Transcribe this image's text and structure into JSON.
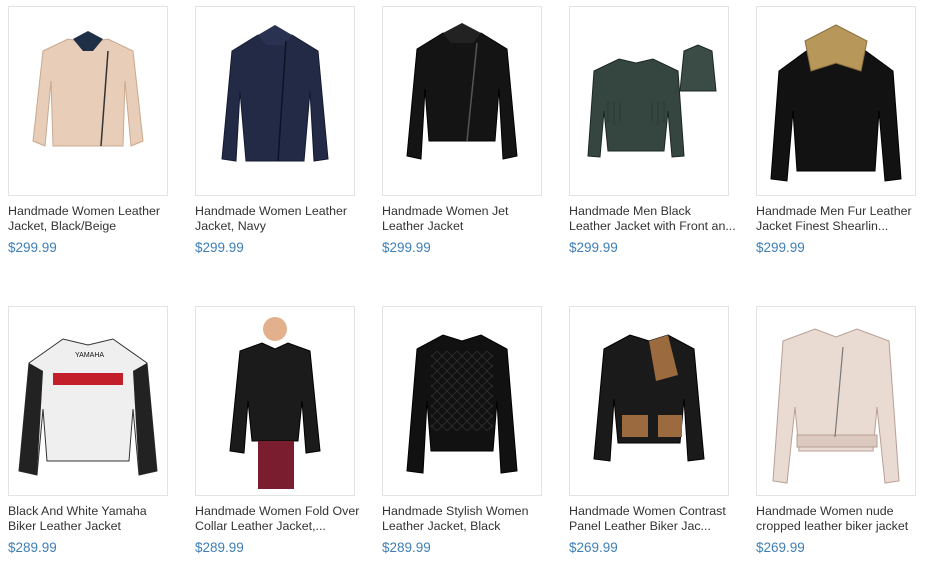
{
  "products": [
    {
      "title_line1": "Handmade Women Leather",
      "title_line2": "Jacket, Black/Beige",
      "price": "$299.99",
      "image": "beige-women-jacket"
    },
    {
      "title_line1": "Handmade Women Leather",
      "title_line2": "Jacket, Navy",
      "price": "$299.99",
      "image": "navy-women-jacket"
    },
    {
      "title_line1": "Handmade Women Jet",
      "title_line2": "Leather Jacket",
      "price": "$299.99",
      "image": "black-jet-jacket"
    },
    {
      "title_line1": "Handmade Men Black",
      "title_line2": "Leather Jacket with Front an...",
      "price": "$299.99",
      "image": "fringe-jacket"
    },
    {
      "title_line1": "Handmade Men Fur Leather",
      "title_line2": "Jacket Finest Shearlin...",
      "price": "$299.99",
      "image": "shearling-jacket"
    },
    {
      "title_line1": "Black And White Yamaha",
      "title_line2": "Biker Leather Jacket",
      "price": "$289.99",
      "image": "yamaha-jacket"
    },
    {
      "title_line1": "Handmade Women Fold Over",
      "title_line2": "Collar Leather Jacket,...",
      "price": "$289.99",
      "image": "fold-collar-jacket"
    },
    {
      "title_line1": "Handmade Stylish Women",
      "title_line2": "Leather Jacket, Black",
      "price": "$289.99",
      "image": "quilted-jacket"
    },
    {
      "title_line1": "Handmade Women Contrast",
      "title_line2": "Panel Leather Biker Jac...",
      "price": "$269.99",
      "image": "contrast-panel-jacket"
    },
    {
      "title_line1": "Handmade Women nude",
      "title_line2": "cropped leather biker jacket",
      "price": "$269.99",
      "image": "nude-biker-jacket"
    }
  ],
  "logo_text": "YAMAHA"
}
